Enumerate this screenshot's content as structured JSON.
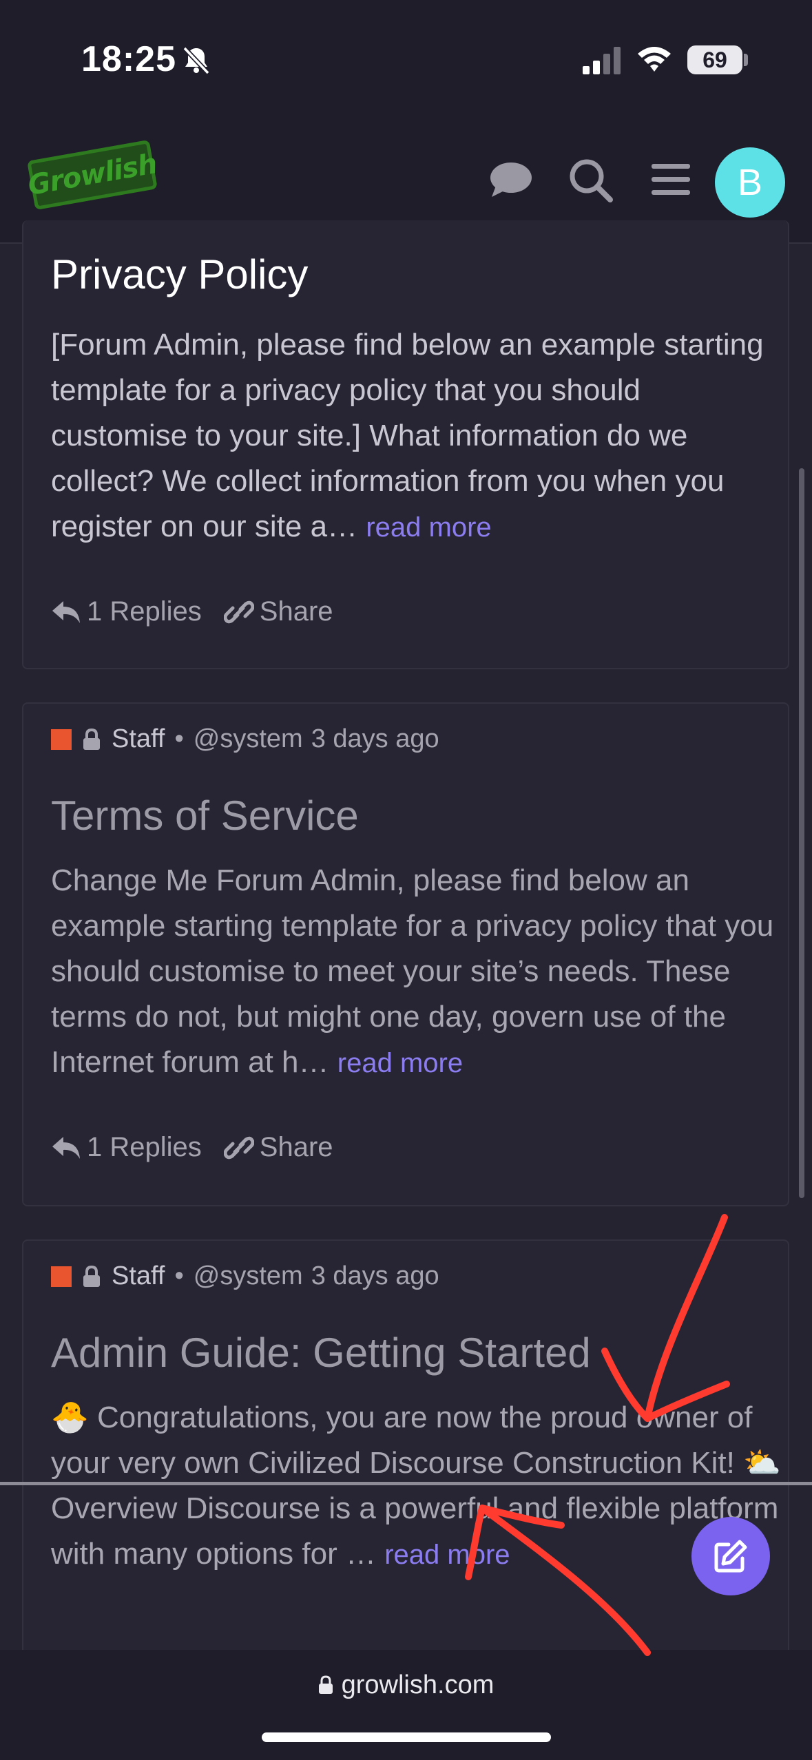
{
  "status_bar": {
    "time": "18:25",
    "battery": "69"
  },
  "header": {
    "logo_text": "Growlish",
    "avatar_letter": "B"
  },
  "posts": [
    {
      "title": "Privacy Policy",
      "excerpt": "[Forum Admin, please find below an example starting template for a privacy policy that you should customise to your site.] What information do we collect? We collect information from you when you register on our site a…",
      "read_more": "read more",
      "replies": "1 Replies",
      "share": "Share"
    },
    {
      "category": "Staff",
      "separator": "•",
      "author": "@system",
      "time": "3 days ago",
      "title": "Terms of Service",
      "excerpt": "Change Me Forum Admin, please find below an example starting template for a privacy policy that you should customise to meet your site’s needs. These terms do not, but might one day, govern use of the Internet forum at h…",
      "read_more": "read more",
      "replies": "1 Replies",
      "share": "Share"
    },
    {
      "category": "Staff",
      "separator": "•",
      "author": "@system",
      "time": "3 days ago",
      "title": "Admin Guide: Getting Started",
      "excerpt_emoji_1": "🐣",
      "excerpt_part_1": "Congratulations, you are now the proud owner of your very own Civilized Discourse Construction Kit!",
      "excerpt_emoji_2": "⛅",
      "excerpt_part_2": "Overview Discourse is a powerful and flexible platform with many options for …",
      "read_more": "read more"
    }
  ],
  "browser": {
    "url": "growlish.com"
  },
  "colors": {
    "background": "#252330",
    "accent": "#8b7df0",
    "category": "#e9552e",
    "avatar": "#5de0e6",
    "fab": "#7b63f0",
    "annotation": "#ff3b30"
  }
}
